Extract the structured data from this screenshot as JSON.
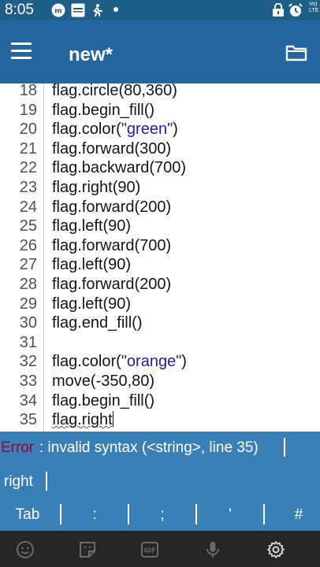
{
  "status_bar": {
    "time": "8:05",
    "network_label": "Vo) LTE"
  },
  "app_bar": {
    "title": "new*"
  },
  "editor": {
    "lines": [
      {
        "num": "18",
        "code": "flag.circle(80,360)"
      },
      {
        "num": "19",
        "code": "flag.begin_fill()"
      },
      {
        "num": "20",
        "pre": "flag.color(",
        "str": "\"green\"",
        "post": ")"
      },
      {
        "num": "21",
        "code": "flag.forward(300)"
      },
      {
        "num": "22",
        "code": "flag.backward(700)"
      },
      {
        "num": "23",
        "code": "flag.right(90)"
      },
      {
        "num": "24",
        "code": "flag.forward(200)"
      },
      {
        "num": "25",
        "code": "flag.left(90)"
      },
      {
        "num": "26",
        "code": "flag.forward(700)"
      },
      {
        "num": "27",
        "code": "flag.left(90)"
      },
      {
        "num": "28",
        "code": "flag.forward(200)"
      },
      {
        "num": "29",
        "code": "flag.left(90)"
      },
      {
        "num": "30",
        "code": "flag.end_fill()"
      },
      {
        "num": "31",
        "code": ""
      },
      {
        "num": "32",
        "pre": "flag.color(",
        "str": "\"orange\"",
        "post": ")"
      },
      {
        "num": "33",
        "code": "move(-350,80)"
      },
      {
        "num": "34",
        "code": "flag.begin_fill()"
      },
      {
        "num": "35",
        "code": "flag.right"
      }
    ]
  },
  "error": {
    "label": "Error",
    "message": ": invalid syntax (<string>, line 35)"
  },
  "input": {
    "value": "right"
  },
  "keys": [
    "Tab",
    ":",
    ";",
    "'",
    "#"
  ]
}
